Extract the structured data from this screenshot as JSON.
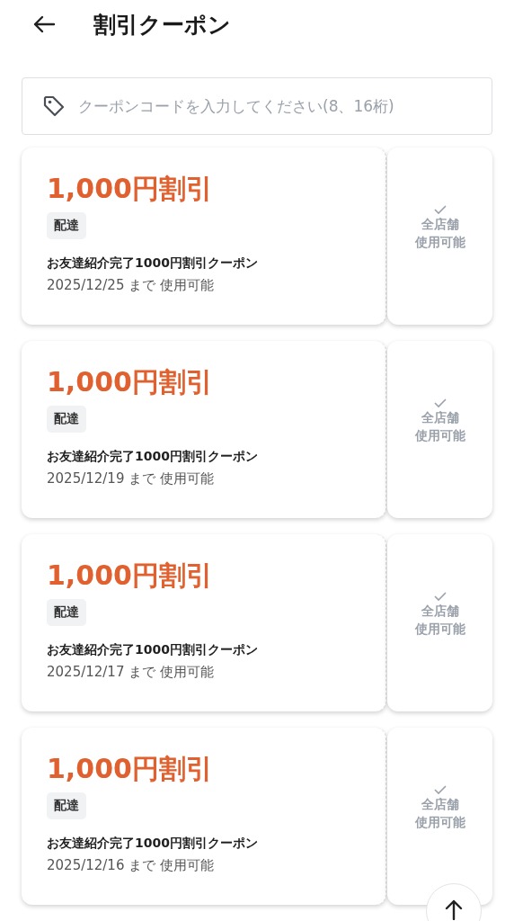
{
  "header": {
    "title": "割引クーポン"
  },
  "search": {
    "placeholder": "クーポンコードを入力してください(8、16桁)"
  },
  "coupons": [
    {
      "amount": "1,000円割引",
      "tag": "配達",
      "name": "お友達紹介完了1000円割引クーポン",
      "expiry": "2025/12/25 まで 使用可能",
      "scope": "全店舗",
      "usage": "使用可能"
    },
    {
      "amount": "1,000円割引",
      "tag": "配達",
      "name": "お友達紹介完了1000円割引クーポン",
      "expiry": "2025/12/19 まで 使用可能",
      "scope": "全店舗",
      "usage": "使用可能"
    },
    {
      "amount": "1,000円割引",
      "tag": "配達",
      "name": "お友達紹介完了1000円割引クーポン",
      "expiry": "2025/12/17 まで 使用可能",
      "scope": "全店舗",
      "usage": "使用可能"
    },
    {
      "amount": "1,000円割引",
      "tag": "配達",
      "name": "お友達紹介完了1000円割引クーポン",
      "expiry": "2025/12/16 まで 使用可能",
      "scope": "全店舗",
      "usage": "使用可能"
    }
  ]
}
